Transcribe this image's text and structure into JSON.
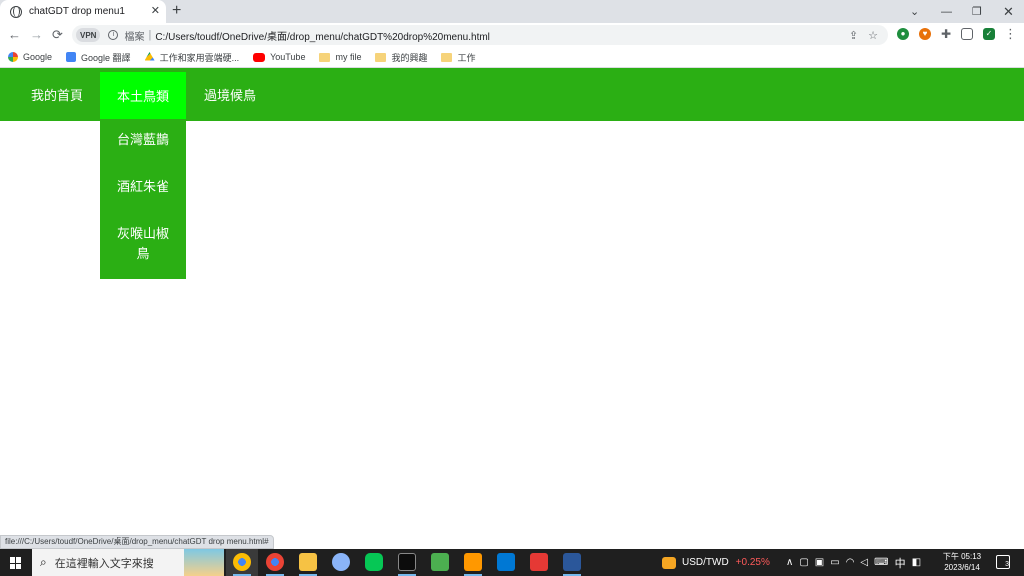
{
  "browser": {
    "tab_title": "chatGDT drop menu1",
    "tab_close": "✕",
    "new_tab": "+",
    "window_controls": {
      "chevron": "⌄",
      "minimize": "—",
      "maximize": "❐",
      "close": "✕"
    },
    "nav": {
      "back": "←",
      "forward": "→",
      "reload": "⟳"
    },
    "vpn_label": "VPN",
    "info_icon": "i",
    "scheme_label": "檔案",
    "separator": "|",
    "url": "C:/Users/toudf/OneDrive/桌面/drop_menu/chatGDT%20drop%20menu.html",
    "share_icon": "⇪",
    "star_icon": "☆",
    "extensions": [
      "shield-icon",
      "heart-icon",
      "puzzle-icon",
      "sidepanel-icon",
      "check-shield-icon",
      "menu-icon"
    ],
    "ext_glyphs": {
      "puzzle": "✚",
      "menu": "⋮",
      "check": "✓",
      "shield": "●",
      "heart": "♥"
    }
  },
  "bookmarks": [
    {
      "label": "Google",
      "icon": "google-icon"
    },
    {
      "label": "Google 翻譯",
      "icon": "translate-icon"
    },
    {
      "label": "工作和家用雲端硬...",
      "icon": "drive-icon"
    },
    {
      "label": "YouTube",
      "icon": "youtube-icon"
    },
    {
      "label": "my file",
      "icon": "folder-icon"
    },
    {
      "label": "我的興趣",
      "icon": "folder-icon"
    },
    {
      "label": "工作",
      "icon": "folder-icon"
    }
  ],
  "page": {
    "menu": [
      {
        "label": "我的首頁"
      },
      {
        "label": "本土鳥類",
        "active": true
      },
      {
        "label": "過境候鳥"
      }
    ],
    "dropdown": [
      "台灣藍鵲",
      "酒紅朱雀",
      "灰喉山椒鳥"
    ],
    "colors": {
      "menu_bg": "#2baf14",
      "active_bg": "#00ff00",
      "text": "#ffffff"
    }
  },
  "status_url": "file:///C:/Users/toudf/OneDrive/桌面/drop_menu/chatGDT drop menu.html#",
  "taskbar": {
    "search_placeholder": "在這裡輸入文字來搜",
    "search_icon": "⌕",
    "apps": [
      "chrome-icon",
      "chrome-icon",
      "file-explorer-icon",
      "inkscape-icon",
      "line-icon",
      "terminal-icon",
      "notepad-icon",
      "sublime-icon",
      "vscode-icon",
      "gift-icon",
      "word-icon"
    ],
    "fx_pair": "USD/TWD",
    "fx_change": "+0.25%",
    "tray_chevron": "∧",
    "ime": "中",
    "clock_time": "下午 05:13",
    "clock_date": "2023/6/14",
    "notifications": "3"
  }
}
